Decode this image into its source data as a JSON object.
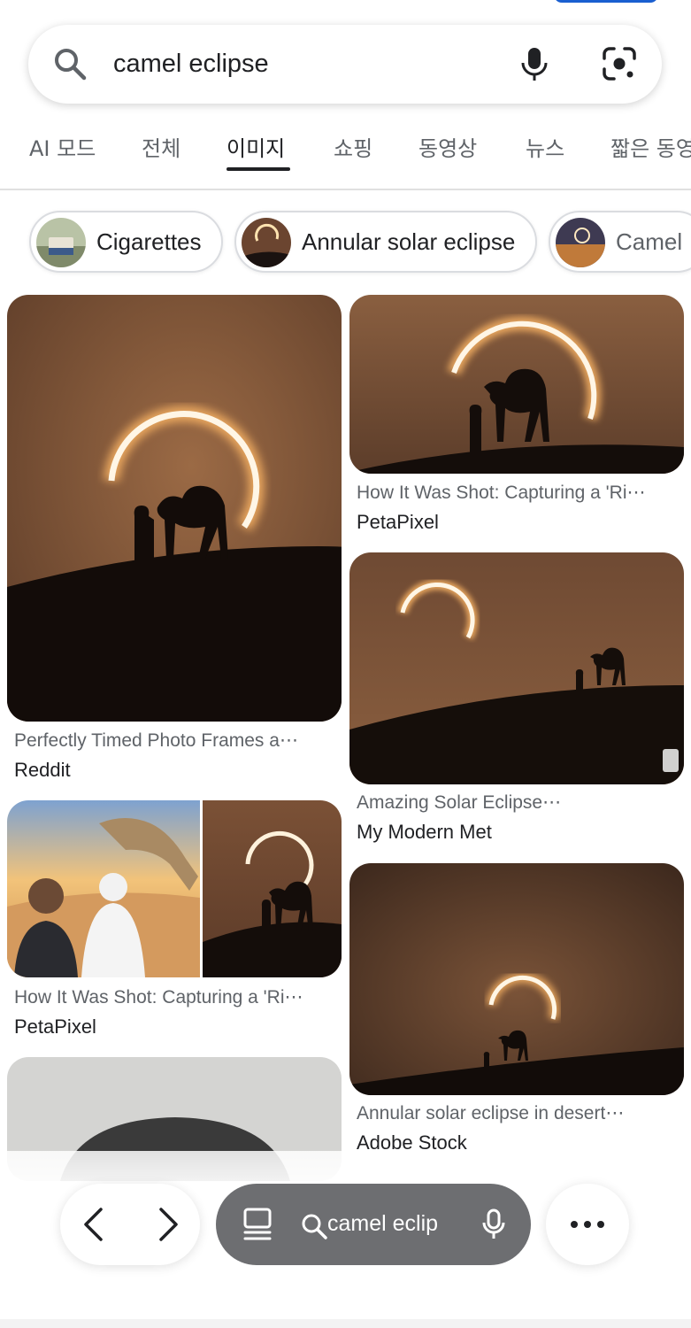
{
  "search": {
    "query": "camel eclipse"
  },
  "tabs": [
    {
      "label": "AI 모드"
    },
    {
      "label": "전체"
    },
    {
      "label": "이미지",
      "active": true
    },
    {
      "label": "쇼핑"
    },
    {
      "label": "동영상"
    },
    {
      "label": "뉴스"
    },
    {
      "label": "짧은 동영"
    }
  ],
  "chips": [
    {
      "label": "Cigarettes"
    },
    {
      "label": "Annular solar eclipse"
    },
    {
      "label": "Camel"
    }
  ],
  "results": [
    {
      "title": "Perfectly Timed Photo Frames a⋯",
      "source": "Reddit"
    },
    {
      "title": "How It Was Shot: Capturing a 'Ri⋯",
      "source": "PetaPixel"
    },
    {
      "title": "How It Was Shot: Capturing a 'Ri⋯",
      "source": "PetaPixel"
    },
    {
      "title": "Amazing Solar Eclipse⋯",
      "source": "My Modern Met"
    },
    {
      "title": "Annular solar eclipse in desert⋯",
      "source": "Adobe Stock"
    }
  ],
  "bottom_bar": {
    "address_text": "camel eclip"
  },
  "icons": {
    "search": "search-icon",
    "mic": "mic-icon",
    "lens": "lens-icon",
    "back": "chevron-left-icon",
    "forward": "chevron-right-icon",
    "tabs": "tabs-icon",
    "more": "more-dots-icon"
  },
  "colors": {
    "accent": "#1a5fd0",
    "address_pill": "#6d6e71",
    "sky_warm": "#8a5a3a"
  }
}
